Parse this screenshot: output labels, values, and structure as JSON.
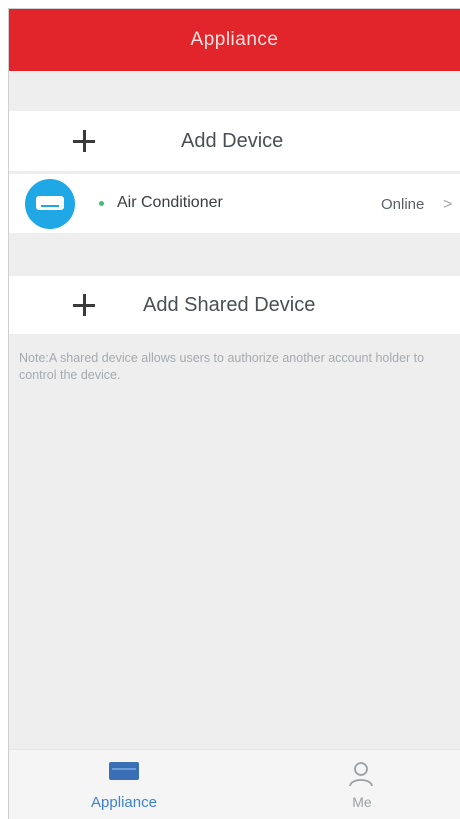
{
  "header": {
    "title": "Appliance"
  },
  "add_device": {
    "label": "Add Device"
  },
  "device": {
    "name": "Air Conditioner",
    "status": "Online",
    "chevron": ">",
    "icon": "air-conditioner-icon",
    "status_color": "#3cc17a"
  },
  "add_shared_device": {
    "label": "Add Shared Device"
  },
  "note": "Note:A shared device allows users to authorize another account holder to control the device.",
  "tabbar": {
    "tabs": [
      {
        "label": "Appliance",
        "icon": "appliance-icon",
        "active": true
      },
      {
        "label": "Me",
        "icon": "person-icon",
        "active": false
      }
    ]
  },
  "colors": {
    "header": "#e1252b",
    "accent_blue": "#20a7e6",
    "active_tab": "#3f82cf"
  }
}
